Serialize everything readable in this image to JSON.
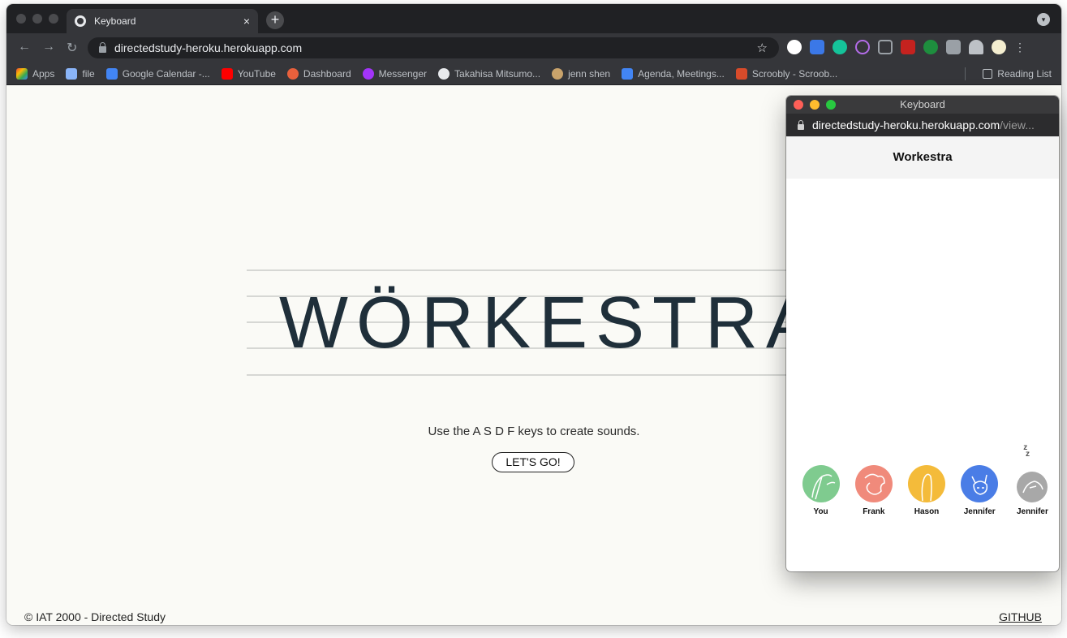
{
  "browser": {
    "tab_title": "Keyboard",
    "tab_close": "×",
    "new_tab": "+",
    "address": "directedstudy-heroku.herokuapp.com",
    "star": "☆",
    "bookmarks": [
      {
        "label": "Apps",
        "icon": "apps-grid-icon",
        "color": "#ea4335"
      },
      {
        "label": "file",
        "icon": "folder-icon",
        "color": "#8ab4f8"
      },
      {
        "label": "Google Calendar -...",
        "icon": "calendar-icon",
        "color": "#4285f4"
      },
      {
        "label": "YouTube",
        "icon": "youtube-icon",
        "color": "#ff0000"
      },
      {
        "label": "Dashboard",
        "icon": "dashboard-icon",
        "color": "#e8603c"
      },
      {
        "label": "Messenger",
        "icon": "messenger-icon",
        "color": "#a334fa"
      },
      {
        "label": "Takahisa Mitsumo...",
        "icon": "globe-icon",
        "color": "#e8eaed"
      },
      {
        "label": "jenn shen",
        "icon": "avatar-icon",
        "color": "#c9a36b"
      },
      {
        "label": "Agenda, Meetings...",
        "icon": "docs-icon",
        "color": "#4285f4"
      },
      {
        "label": "Scroobly - Scroob...",
        "icon": "scroobly-icon",
        "color": "#d84b2a"
      }
    ],
    "reading_list": "Reading List"
  },
  "page": {
    "logo": "WÖRKESTRA",
    "instructions": "Use the A S D F keys to create sounds.",
    "go_button": "LET'S GO!",
    "footer_left": "© IAT 2000 - Directed Study",
    "footer_right": "GITHUB"
  },
  "popup": {
    "window_title": "Keyboard",
    "url_main": "directedstudy-heroku.herokuapp.com",
    "url_dim": "/view...",
    "header": "Workestra",
    "sleep_indicator": "z z",
    "players": [
      {
        "name": "You",
        "color": "#7fcb8f",
        "icon": "plant-creature-icon"
      },
      {
        "name": "Frank",
        "color": "#f08a7b",
        "icon": "squirrel-icon"
      },
      {
        "name": "Hason",
        "color": "#f4bb3a",
        "icon": "ghost-creature-icon"
      },
      {
        "name": "Jennifer",
        "color": "#4a7de6",
        "icon": "cat-face-icon"
      },
      {
        "name": "Jennifer",
        "color": "#a8a8a8",
        "icon": "sleeping-creature-icon"
      }
    ]
  }
}
